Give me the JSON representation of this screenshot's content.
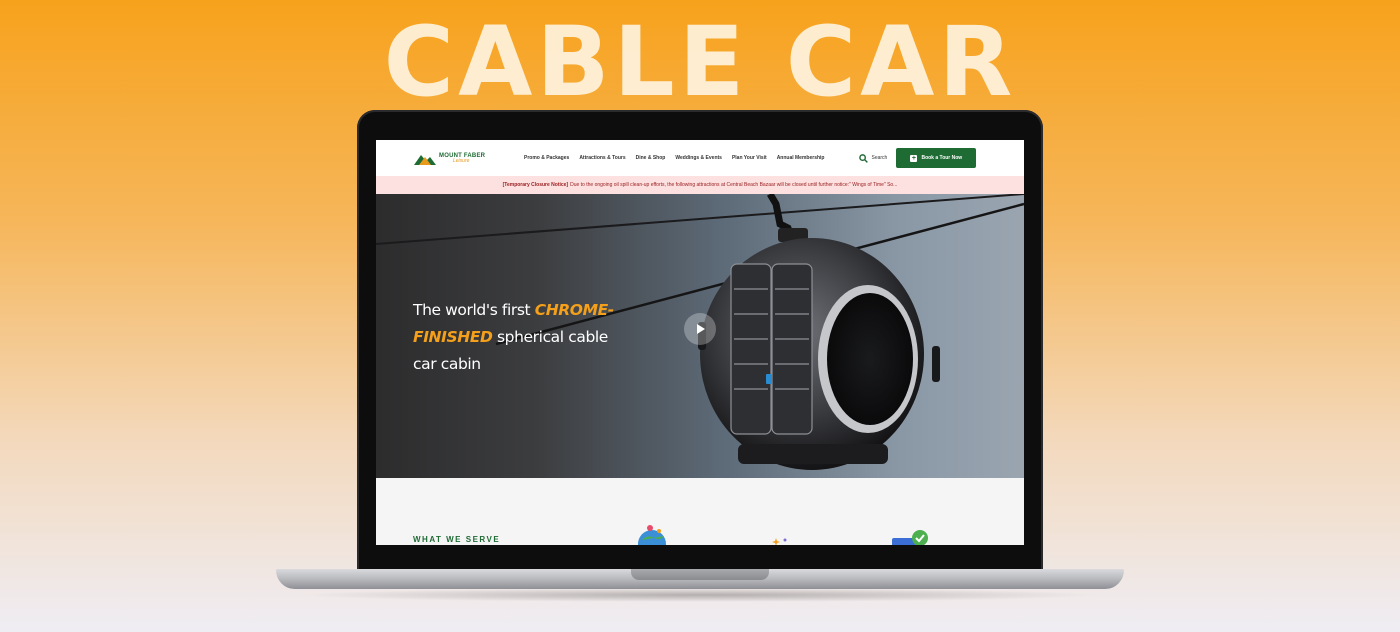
{
  "banner_title": "CABLE CAR",
  "site": {
    "logo": {
      "top": "MOUNT FABER",
      "bottom": "Leisure"
    },
    "nav": [
      "Promo & Packages",
      "Attractions & Tours",
      "Dine & Shop",
      "Weddings & Events",
      "Plan Your Visit",
      "Annual Membership"
    ],
    "search_label": "Search",
    "book_label": "Book a Tour Now"
  },
  "notice": {
    "tag": "[Temporary Closure Notice]",
    "text": "Due to the ongoing oil spill clean-up efforts, the following attractions at Central Beach Bazaar will be closed until further notice:\" Wings of Time\" So..."
  },
  "hero": {
    "line_start": "The world's first ",
    "accent_1": "CHROME-",
    "accent_2": "FINISHED",
    "line_end": " spherical cable car cabin"
  },
  "section": {
    "label": "WHAT WE SERVE"
  },
  "colors": {
    "brand_green": "#1e6b34",
    "brand_orange": "#f5a01a",
    "notice_bg": "#fde0e0"
  }
}
